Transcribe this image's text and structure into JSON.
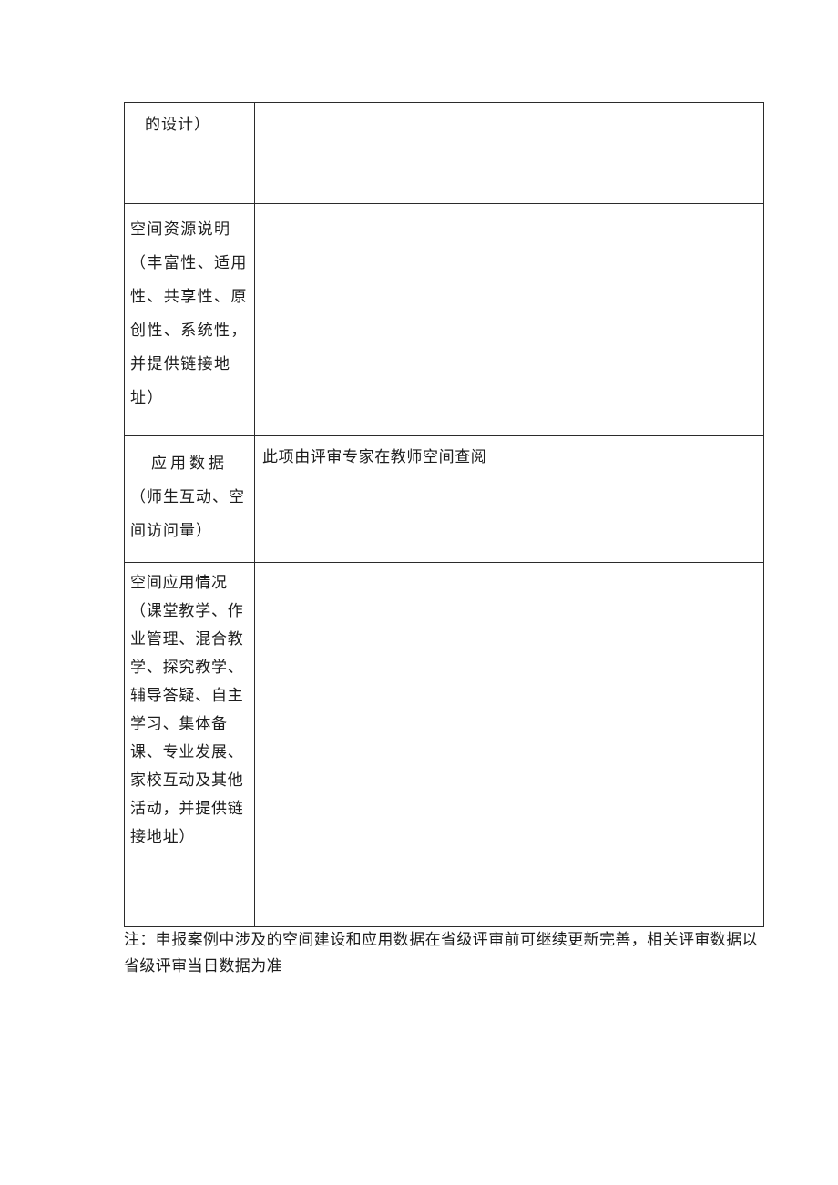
{
  "document": {
    "type": "evaluation-form-table",
    "rows": [
      {
        "label": "的设计）",
        "value": ""
      },
      {
        "label": "空间资源说明（丰富性、适用性、共享性、原创性、系统性，并提供链接地址）",
        "value": ""
      },
      {
        "label_lead": "应用数据",
        "label_rest": "（师生互动、空间访问量）",
        "value": "此项由评审专家在教师空间查阅"
      },
      {
        "label": "空间应用情况（课堂教学、作业管理、混合教学、探究教学、辅导答疑、自主学习、集体备课、专业发展、家校互动及其他活动，并提供链接地址）",
        "value": ""
      }
    ]
  },
  "footnote": {
    "text": "注：申报案例中涉及的空间建设和应用数据在省级评审前可继续更新完善，相关评审数据以省级评审当日数据为准"
  },
  "colors": {
    "border": "#2b2b2b",
    "text": "#1d1d1d",
    "background": "#ffffff"
  }
}
